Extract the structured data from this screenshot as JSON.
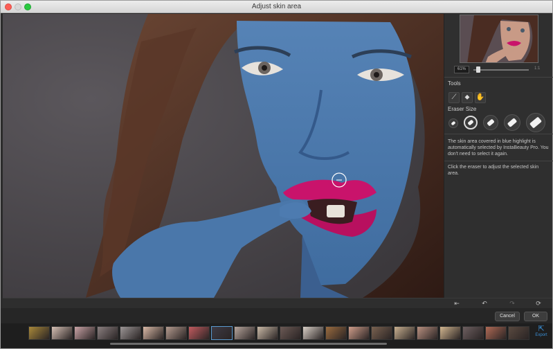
{
  "window": {
    "title": "Adjust skin area"
  },
  "navigator": {
    "zoom_value": "61%",
    "fit_label": "1:1",
    "zoom_fraction": 0.06
  },
  "tools": {
    "heading": "Tools",
    "items": [
      {
        "name": "magic-brush-icon",
        "glyph": "⟋"
      },
      {
        "name": "eraser-tool-icon",
        "glyph": "⬥"
      },
      {
        "name": "hand-tool-icon",
        "glyph": "✋"
      }
    ]
  },
  "eraser": {
    "heading": "Eraser Size",
    "sizes": [
      "xs",
      "s",
      "m",
      "l",
      "xl"
    ],
    "selected_index": 1
  },
  "help": {
    "line1": "The skin area covered in blue highlight is automatically selected by InstaBeauty Pro. You don't need to select it again.",
    "line2": "Click the eraser to adjust the selected skin area."
  },
  "history": {
    "reset_icon": "reset-start-icon",
    "undo_icon": "undo-icon",
    "redo_icon": "redo-icon",
    "refresh_icon": "restore-icon"
  },
  "actions": {
    "cancel": "Cancel",
    "ok": "OK"
  },
  "export": {
    "label": "Export"
  },
  "colors": {
    "skin_mask": "#4a79ad",
    "hair": "#4a2c22",
    "background": "#4e4a4f",
    "lips": "#c9136b",
    "accent": "#3a8fd6"
  },
  "filmstrip": {
    "thumbs": [
      "#a9893a",
      "#d6c0b4",
      "#c9a3a6",
      "#8a7f80",
      "#9c9696",
      "#d9b9a6",
      "#b49b8f",
      "#c25b5f",
      "#3d3a44",
      "#b6a59c",
      "#c9b9a6",
      "#6c5a55",
      "#d8cfc6",
      "#9a6b3f",
      "#cf9d8a",
      "#7a6250",
      "#c8b090",
      "#b89080",
      "#d1b58f",
      "#6d5f60",
      "#b06a55",
      "#5a4a40"
    ],
    "selected_index": 8
  }
}
